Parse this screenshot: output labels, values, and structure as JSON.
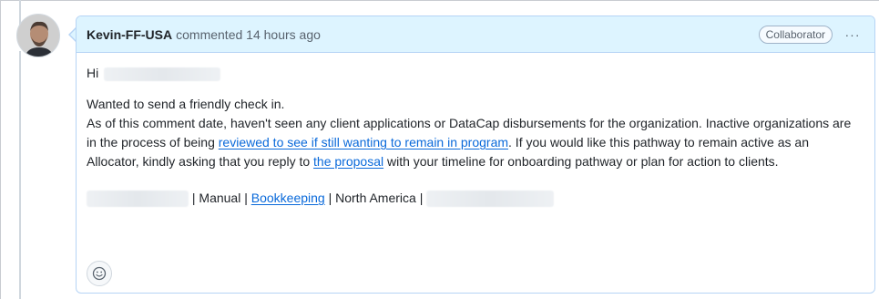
{
  "comment": {
    "author": "Kevin-FF-USA",
    "meta_text": "commented 14 hours ago",
    "role_badge": "Collaborator",
    "kebab_glyph": "···",
    "greeting": "Hi",
    "line1": "Wanted to send a friendly check in.",
    "para_start": "As of this comment date, haven't seen any client applications or DataCap disbursements for the organization. Inactive organizations are in the process of being ",
    "link_review": "reviewed to see if still wanting to remain in program",
    "para_mid": ". If you would like this pathway to remain active as an Allocator, kindly asking that you reply to ",
    "link_proposal": "the proposal",
    "para_end": " with your timeline for onboarding pathway or plan for action to clients.",
    "footer_manual": " | Manual | ",
    "footer_link": "Bookkeeping",
    "footer_region": " | North America | "
  },
  "icons": {
    "avatar": "avatar-photo",
    "reaction": "smiley-icon"
  },
  "colors": {
    "header_bg": "#ddf4ff",
    "border": "#b6d4f5",
    "link": "#0969da"
  }
}
